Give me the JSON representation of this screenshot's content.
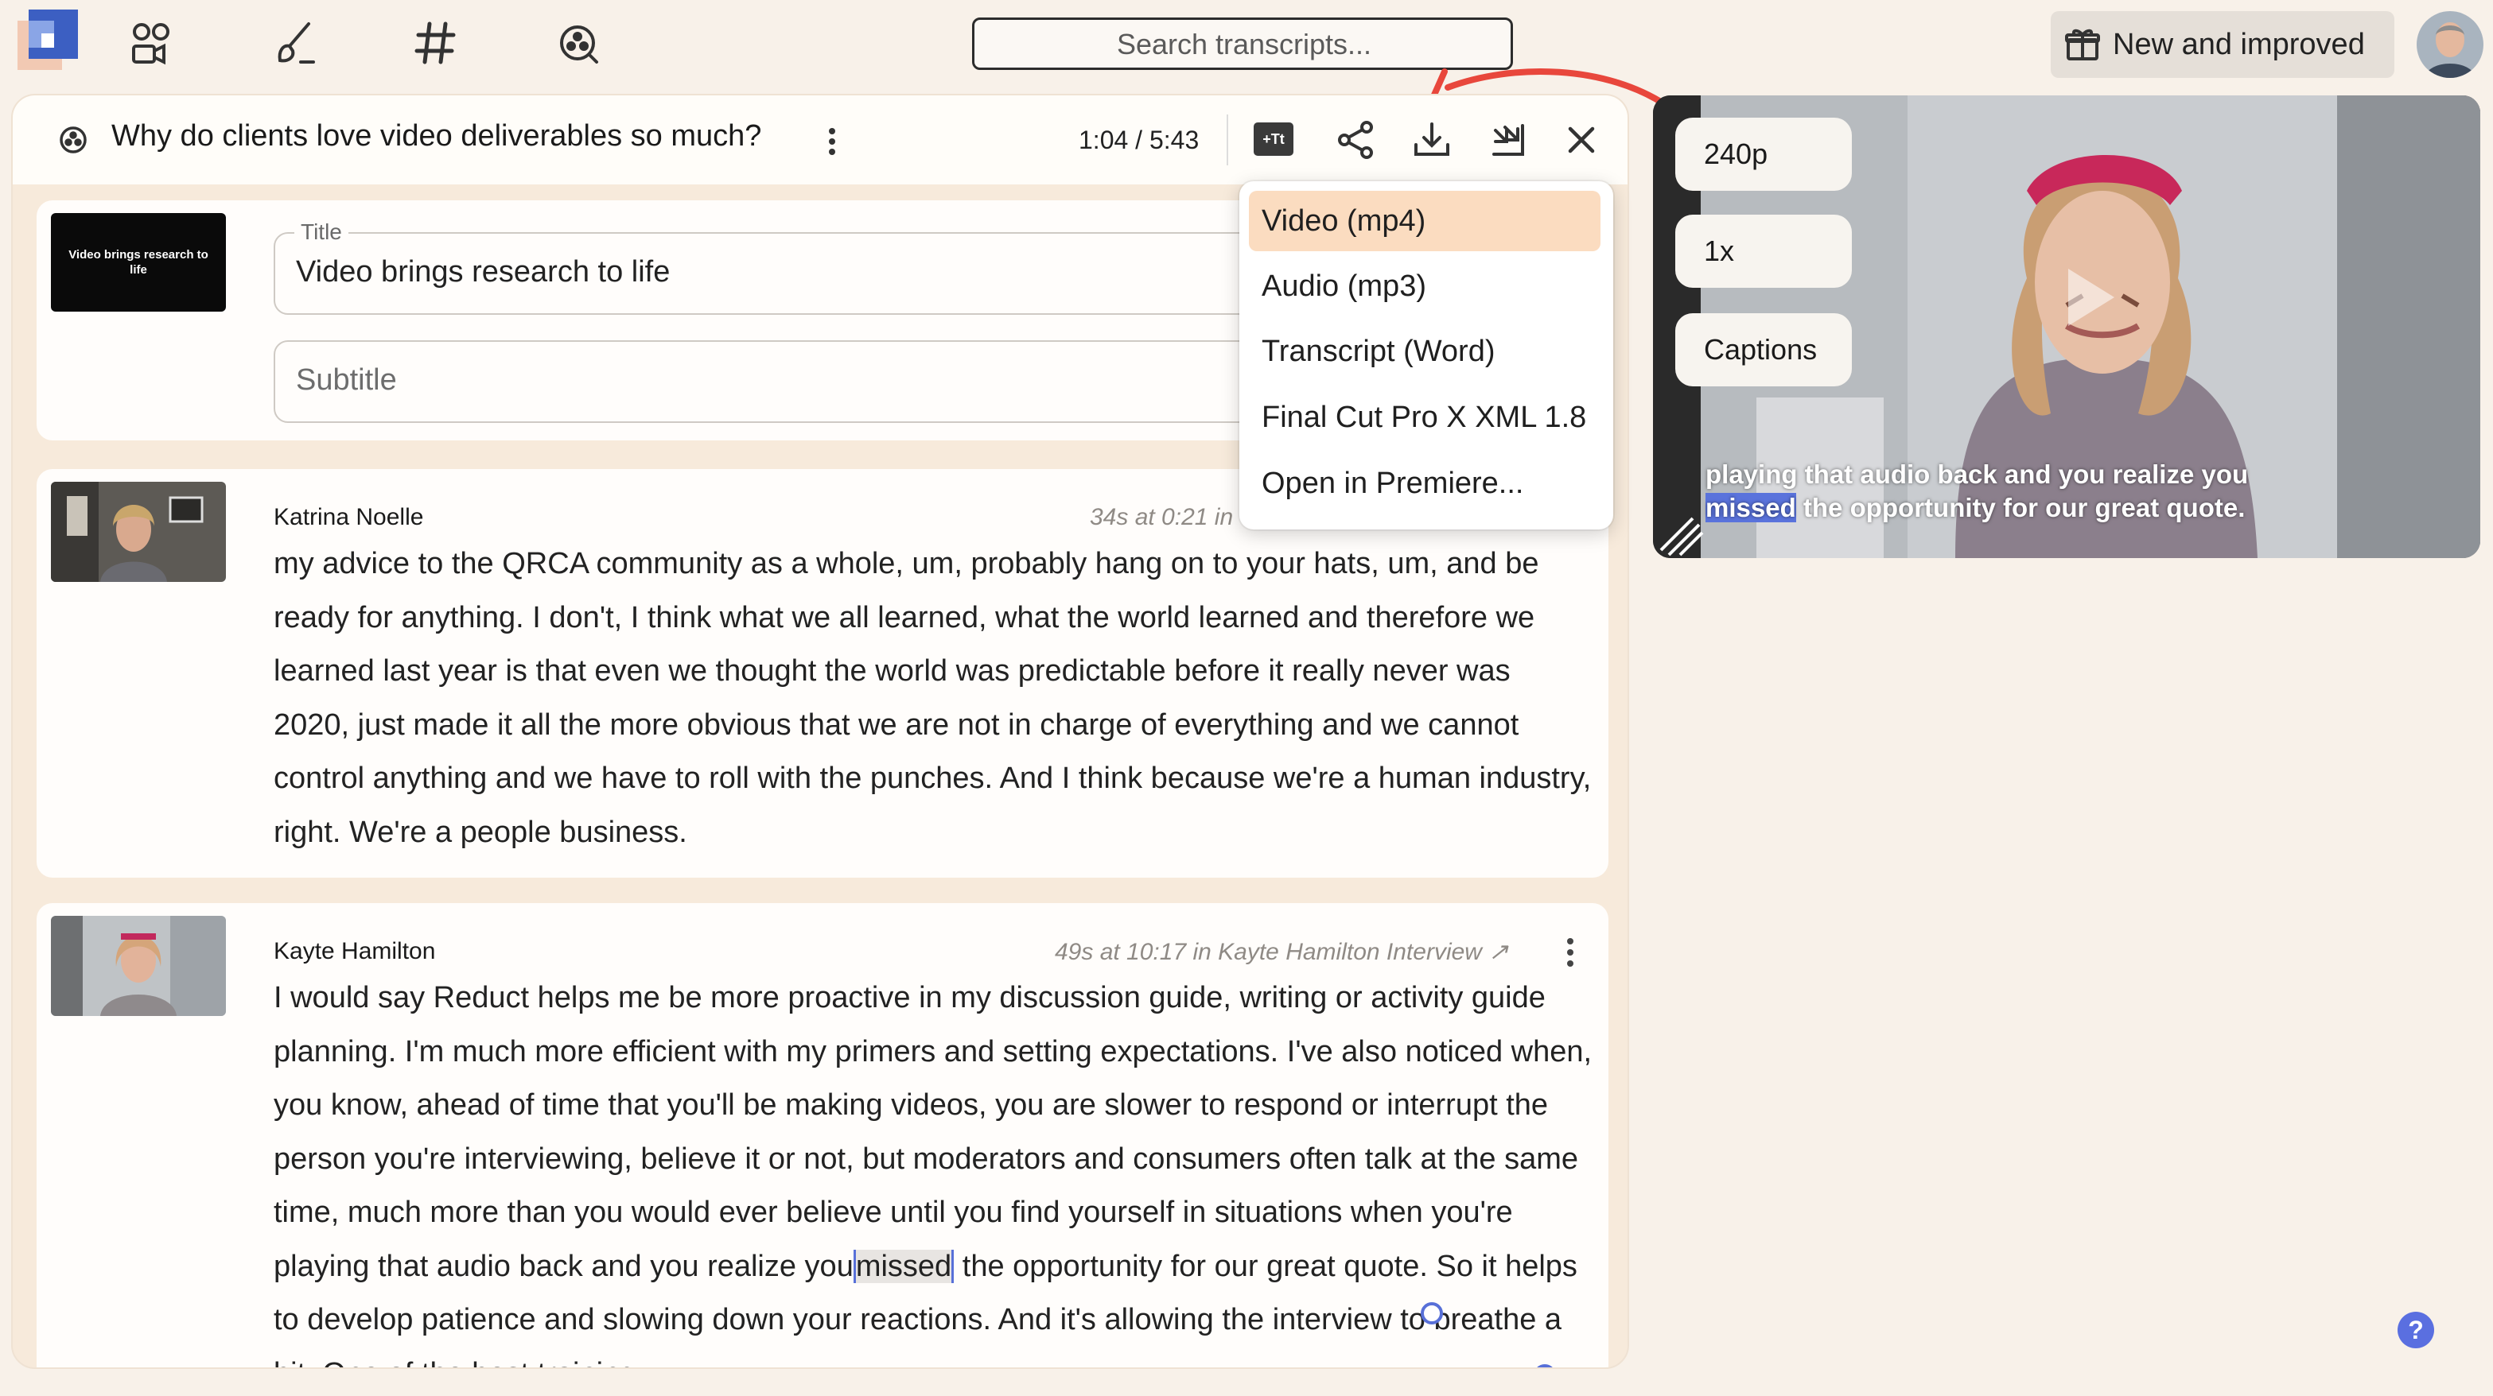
{
  "nav": {
    "icons": [
      "logo",
      "people-video-icon",
      "brush-icon",
      "hashtag-icon",
      "search-reel-icon"
    ]
  },
  "search": {
    "placeholder": "Search transcripts..."
  },
  "header_right": {
    "new_label": "New and improved"
  },
  "reel": {
    "title": "Why do clients love video deliverables so much?",
    "time": "1:04 / 5:43",
    "tt_badge": "+Tt"
  },
  "title_card": {
    "thumb_text": "Video brings research to life",
    "title_label": "Title",
    "title_value": "Video brings research to life",
    "subtitle_placeholder": "Subtitle"
  },
  "quotes": [
    {
      "speaker": "Katrina Noelle",
      "meta": "34s at 0:21 in",
      "text": "my advice to the QRCA community as a whole, um, probably hang on to your hats, um, and be ready for anything. I don't, I think what we all learned, what the world learned and therefore we learned last year is that even we thought the world was predictable before it really never was 2020, just made it all the more obvious that we are not in charge of everything and we cannot control anything and we have to roll with the punches. And I think because we're a human industry, right. We're a people business."
    },
    {
      "speaker": "Kayte Hamilton",
      "meta": "49s at 10:17 in Kayte Hamilton Interview",
      "text_before": "I would say Reduct helps me be more proactive in my discussion guide, writing or activity guide planning. I'm much more efficient with my primers and setting expectations. I've also noticed when, you know, ahead of time that you'll be making videos, you are slower to respond or interrupt the person you're interviewing, believe it or not, but moderators and consumers often talk at the same time, much more than you would ever believe until you find yourself in situations when you're playing that audio back and you realize you",
      "selected": "missed",
      "text_after": " the opportunity for our great quote. So it helps to develop patience and slowing down your reactions. And it's allowing the interview to breathe a bit. One of the best training"
    }
  ],
  "export_menu": {
    "items": [
      "Video (mp4)",
      "Audio (mp3)",
      "Transcript (Word)",
      "Final Cut Pro X XML 1.8",
      "Open in Premiere..."
    ],
    "active_index": 0
  },
  "video": {
    "quality": "240p",
    "speed": "1x",
    "captions_label": "Captions",
    "caption_before": "playing that audio back and you realize you ",
    "caption_highlight": "missed",
    "caption_after": " the opportunity for our great quote."
  },
  "colors": {
    "background": "#f8f1e9",
    "accent_red": "#e8473c",
    "selection_blue": "#5870d8",
    "menu_active": "#fbdcc0"
  },
  "help": {
    "label": "?"
  }
}
